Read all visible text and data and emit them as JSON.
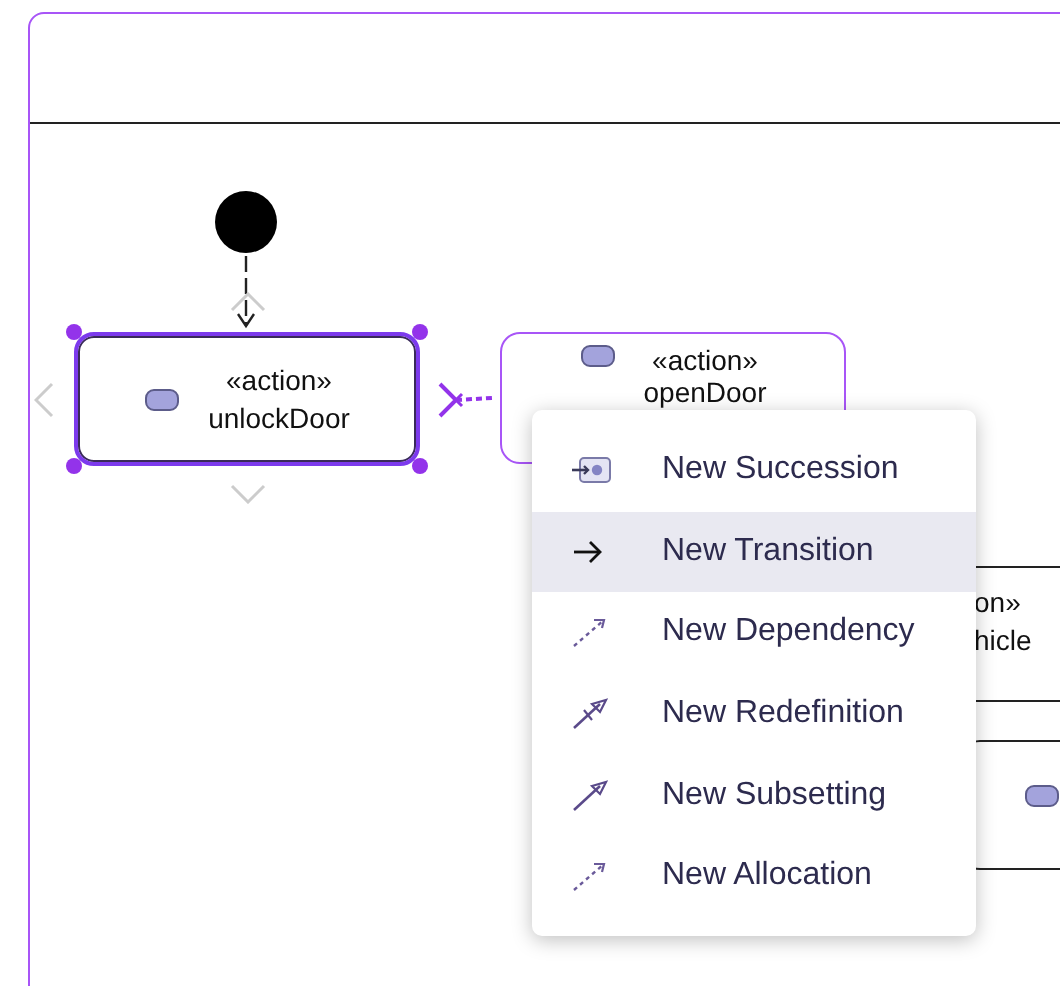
{
  "nodes": [
    {
      "kind": "initial"
    },
    {
      "kind": "action",
      "stereotype": "«action»",
      "name": "unlockDoor",
      "selected": true
    },
    {
      "kind": "action",
      "stereotype": "«action»",
      "name": "openDoor",
      "selected": false
    },
    {
      "kind": "cut-text",
      "lines": [
        "on»",
        "hicle"
      ]
    },
    {
      "kind": "cut-action"
    }
  ],
  "menu": {
    "items": [
      {
        "kind": "succession",
        "label": "New Succession",
        "selected": false
      },
      {
        "kind": "transition",
        "label": "New Transition",
        "selected": true
      },
      {
        "kind": "dependency",
        "label": "New Dependency",
        "selected": false
      },
      {
        "kind": "redefinition",
        "label": "New Redefinition",
        "selected": false
      },
      {
        "kind": "subsetting",
        "label": "New Subsetting",
        "selected": false
      },
      {
        "kind": "allocation",
        "label": "New Allocation",
        "selected": false
      }
    ]
  }
}
